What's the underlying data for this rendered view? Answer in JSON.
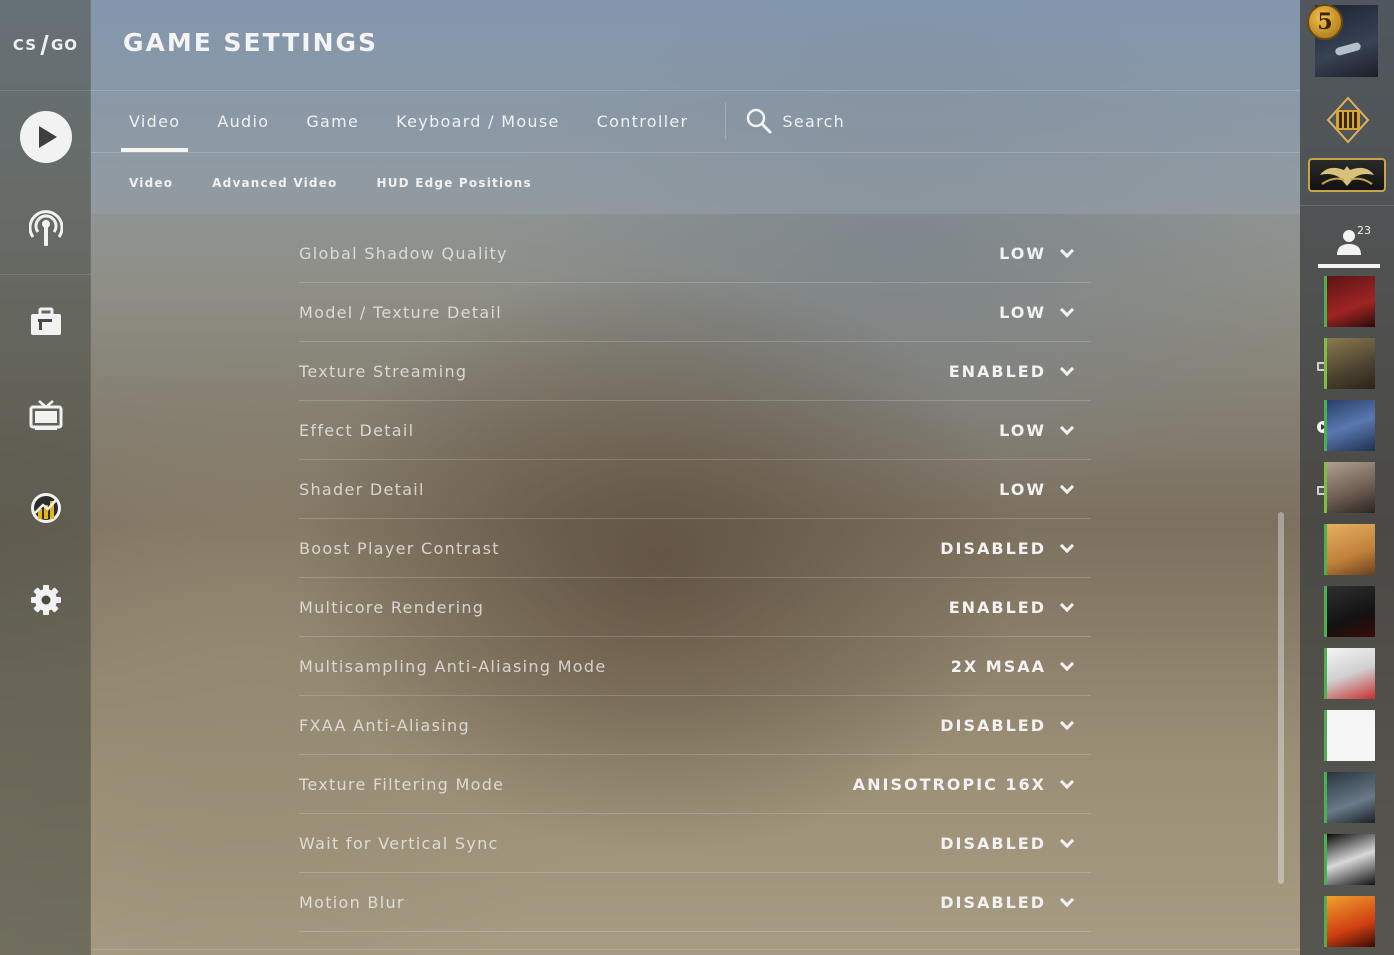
{
  "app": {
    "logo_left": "CS",
    "logo_right": "GO"
  },
  "header": {
    "title": "GAME SETTINGS"
  },
  "tabs": [
    {
      "label": "Video",
      "active": true
    },
    {
      "label": "Audio",
      "active": false
    },
    {
      "label": "Game",
      "active": false
    },
    {
      "label": "Keyboard / Mouse",
      "active": false
    },
    {
      "label": "Controller",
      "active": false
    }
  ],
  "search": {
    "label": "Search"
  },
  "subtabs": [
    {
      "label": "Video"
    },
    {
      "label": "Advanced Video"
    },
    {
      "label": "HUD Edge Positions"
    }
  ],
  "settings": [
    {
      "label": "Global Shadow Quality",
      "value": "LOW"
    },
    {
      "label": "Model / Texture Detail",
      "value": "LOW"
    },
    {
      "label": "Texture Streaming",
      "value": "ENABLED"
    },
    {
      "label": "Effect Detail",
      "value": "LOW"
    },
    {
      "label": "Shader Detail",
      "value": "LOW"
    },
    {
      "label": "Boost Player Contrast",
      "value": "DISABLED"
    },
    {
      "label": "Multicore Rendering",
      "value": "ENABLED"
    },
    {
      "label": "Multisampling Anti-Aliasing Mode",
      "value": "2X MSAA"
    },
    {
      "label": "FXAA Anti-Aliasing",
      "value": "DISABLED"
    },
    {
      "label": "Texture Filtering Mode",
      "value": "ANISOTROPIC 16X"
    },
    {
      "label": "Wait for Vertical Sync",
      "value": "DISABLED"
    },
    {
      "label": "Motion Blur",
      "value": "DISABLED"
    }
  ],
  "profile": {
    "level": "5",
    "friend_count": "23"
  },
  "colors": {
    "friend_online": "#4caf50",
    "friend_ingame": "#7fbf3f"
  },
  "friends": [
    {
      "avatar_color": "#7a1f1f",
      "status": "online"
    },
    {
      "avatar_color": "#6a6040",
      "status": "ingame"
    },
    {
      "avatar_color": "#3a4f7a",
      "status": "watching"
    },
    {
      "avatar_color": "#8a7a70",
      "status": "ingame"
    },
    {
      "avatar_color": "#c8903a",
      "status": "online"
    },
    {
      "avatar_color": "#1c1c1c",
      "status": "online"
    },
    {
      "avatar_color": "#e6e6e6",
      "status": "online"
    },
    {
      "avatar_color": "#f6f6f6",
      "status": "online"
    },
    {
      "avatar_color": "#5a6a78",
      "status": "online"
    },
    {
      "avatar_color": "#202020",
      "status": "online"
    },
    {
      "avatar_color": "#d8501a",
      "status": "online"
    }
  ]
}
